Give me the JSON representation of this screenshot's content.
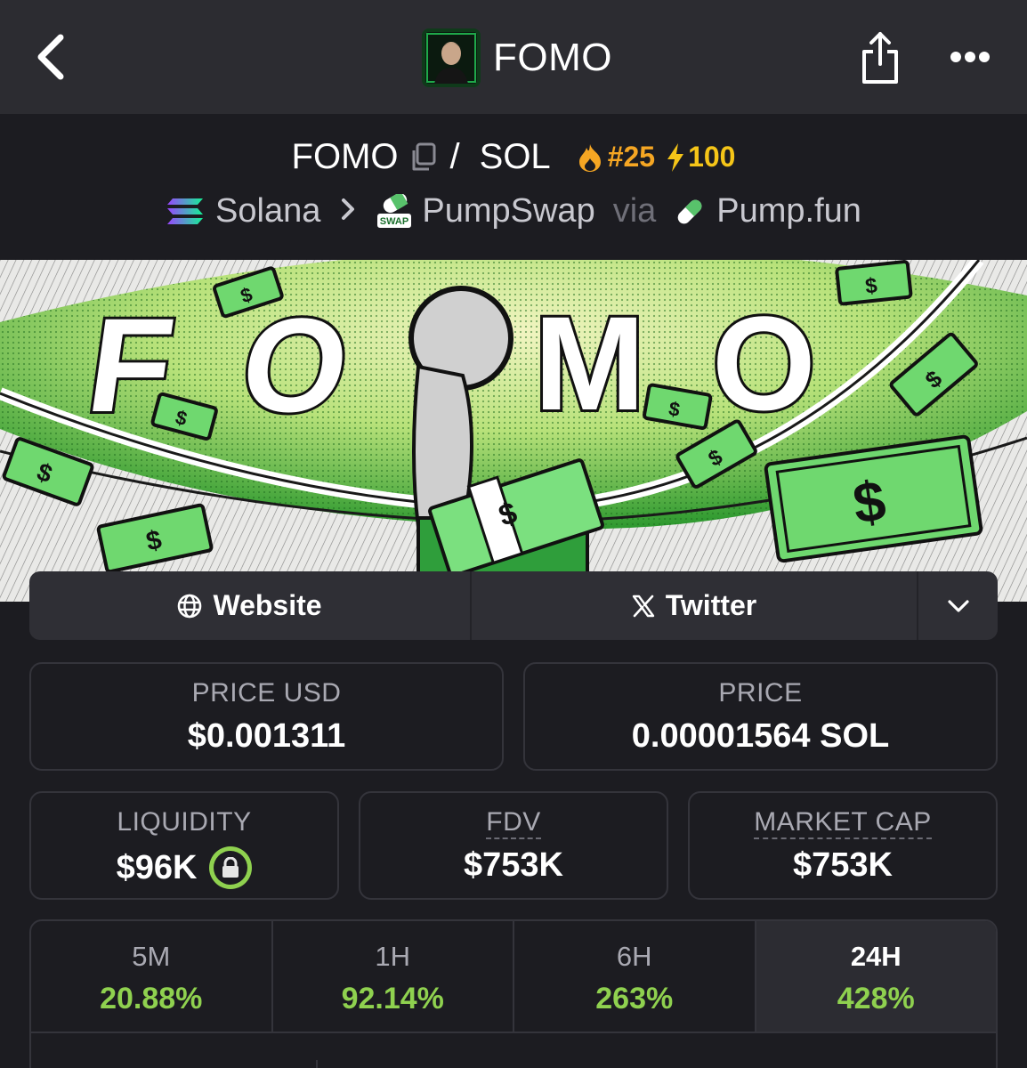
{
  "topbar": {
    "title": "FOMO"
  },
  "pair": {
    "token": "FOMO",
    "separator": "/",
    "quote": "SOL",
    "rank": "#25",
    "boost": "100"
  },
  "chain": {
    "network": "Solana",
    "dex": "PumpSwap",
    "via": "via",
    "launchpad": "Pump.fun"
  },
  "banner": {
    "letters": [
      "F",
      "O",
      "O",
      "M",
      "O"
    ]
  },
  "links": {
    "website": "Website",
    "twitter": "Twitter"
  },
  "stats": {
    "price_usd_label": "PRICE USD",
    "price_usd": "$0.001311",
    "price_label": "PRICE",
    "price": "0.00001564 SOL",
    "liquidity_label": "LIQUIDITY",
    "liquidity": "$96K",
    "fdv_label": "FDV",
    "fdv": "$753K",
    "mcap_label": "MARKET CAP",
    "mcap": "$753K"
  },
  "timeframes": [
    {
      "label": "5M",
      "value": "20.88%"
    },
    {
      "label": "1H",
      "value": "92.14%"
    },
    {
      "label": "6H",
      "value": "263%"
    },
    {
      "label": "24H",
      "value": "428%"
    }
  ],
  "colors": {
    "positive": "#8fd14f",
    "rank": "#f5a623",
    "boost": "#f5c518",
    "background": "#1c1c21"
  }
}
